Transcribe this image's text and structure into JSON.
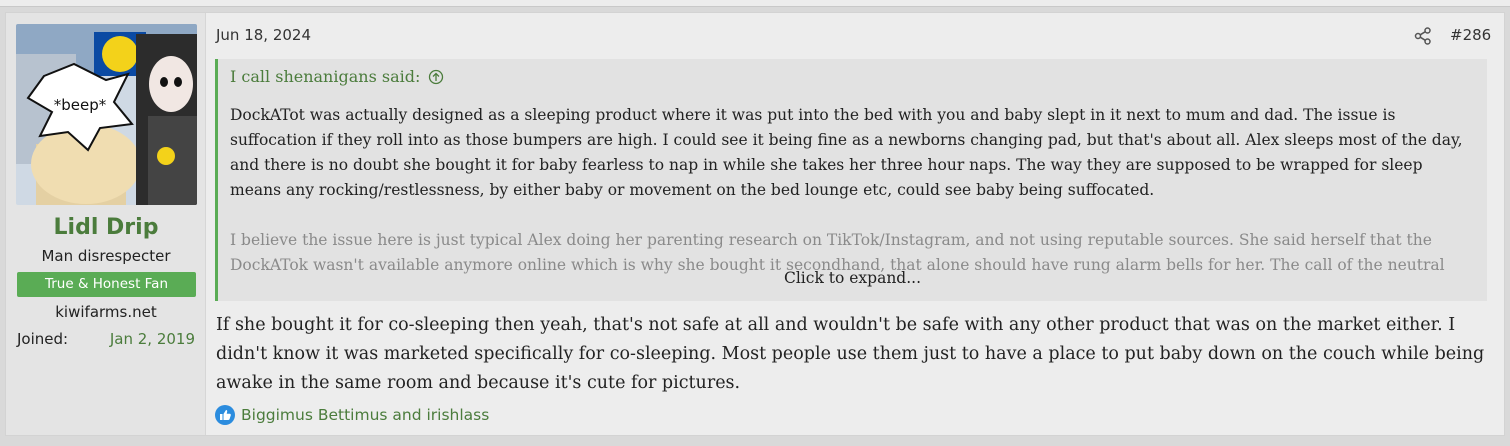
{
  "post": {
    "date": "Jun 18, 2024",
    "number": "#286",
    "colors": {
      "accent": "#5aac55",
      "link": "#4b7c3c"
    }
  },
  "user": {
    "name": "Lidl Drip",
    "title": "Man disrespecter",
    "banner": "True & Honest Fan",
    "site": "kiwifarms.net",
    "joined_label": "Joined:",
    "joined_value": "Jan 2, 2019",
    "avatar_text": "*beep*"
  },
  "quote": {
    "author": "I call shenanigans said:",
    "paragraph1": "DockATot was actually designed as a sleeping product where it was put into the bed with you and baby slept in it next to mum and dad. The issue is suffocation if they roll into as those bumpers are high. I could see it being fine as a newborns changing pad, but that's about all. Alex sleeps most of the day, and there is no doubt she bought it for baby fearless to nap in while she takes her three hour naps. The way they are supposed to be wrapped for sleep means any rocking/restlessness, by either baby or movement on the bed lounge etc, could see baby being suffocated.",
    "paragraph2": "I believe the issue here is just typical Alex doing her parenting research on TikTok/Instagram, and not using reputable sources. She said herself that the DockATok wasn't available anymore online which is why she bought it secondhand, that alone should have rung alarm bells for her. The call of the neutral",
    "expand_label": "Click to expand..."
  },
  "message": "If she bought it for co-sleeping then yeah, that's not safe at all and wouldn't be safe with any other product that was on the market either. I didn't know it was marketed specifically for co-sleeping. Most people use them just to have a place to put baby down on the couch while being awake in the same room and because it's cute for pictures.",
  "reactions": {
    "icon": "like-icon",
    "text": "Biggimus Bettimus and irishlass"
  }
}
